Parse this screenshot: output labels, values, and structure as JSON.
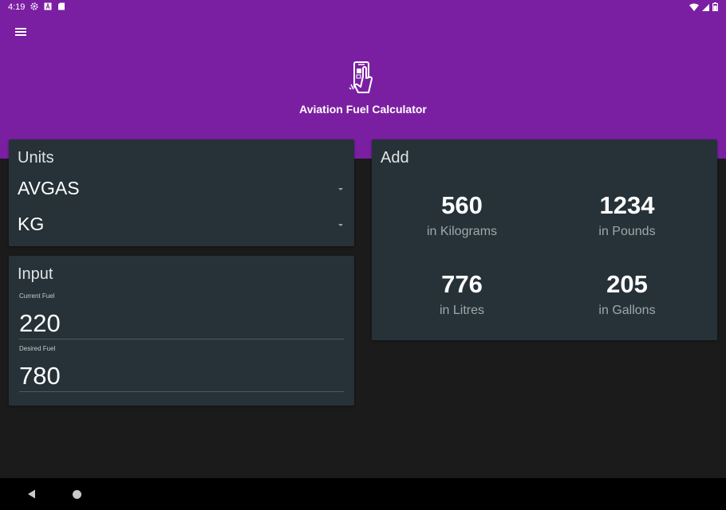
{
  "status_bar": {
    "time": "4:19",
    "icons_left": [
      "settings-icon",
      "a-box-icon",
      "sd-card-icon"
    ],
    "icons_right": [
      "wifi-icon",
      "signal-icon",
      "battery-icon"
    ]
  },
  "app": {
    "title": "Aviation Fuel Calculator",
    "header_color": "#7b1fa2",
    "card_color": "#263238"
  },
  "units_card": {
    "title": "Units",
    "fuel_type": "AVGAS",
    "unit": "KG"
  },
  "input_card": {
    "title": "Input",
    "current_fuel_label": "Current Fuel",
    "current_fuel_value": "220",
    "desired_fuel_label": "Desired Fuel",
    "desired_fuel_value": "780"
  },
  "add_card": {
    "title": "Add",
    "results": [
      {
        "value": "560",
        "label": "in Kilograms"
      },
      {
        "value": "1234",
        "label": "in Pounds"
      },
      {
        "value": "776",
        "label": "in Litres"
      },
      {
        "value": "205",
        "label": "in Gallons"
      }
    ]
  },
  "nav": {
    "icons": [
      "back-icon",
      "home-icon"
    ]
  }
}
